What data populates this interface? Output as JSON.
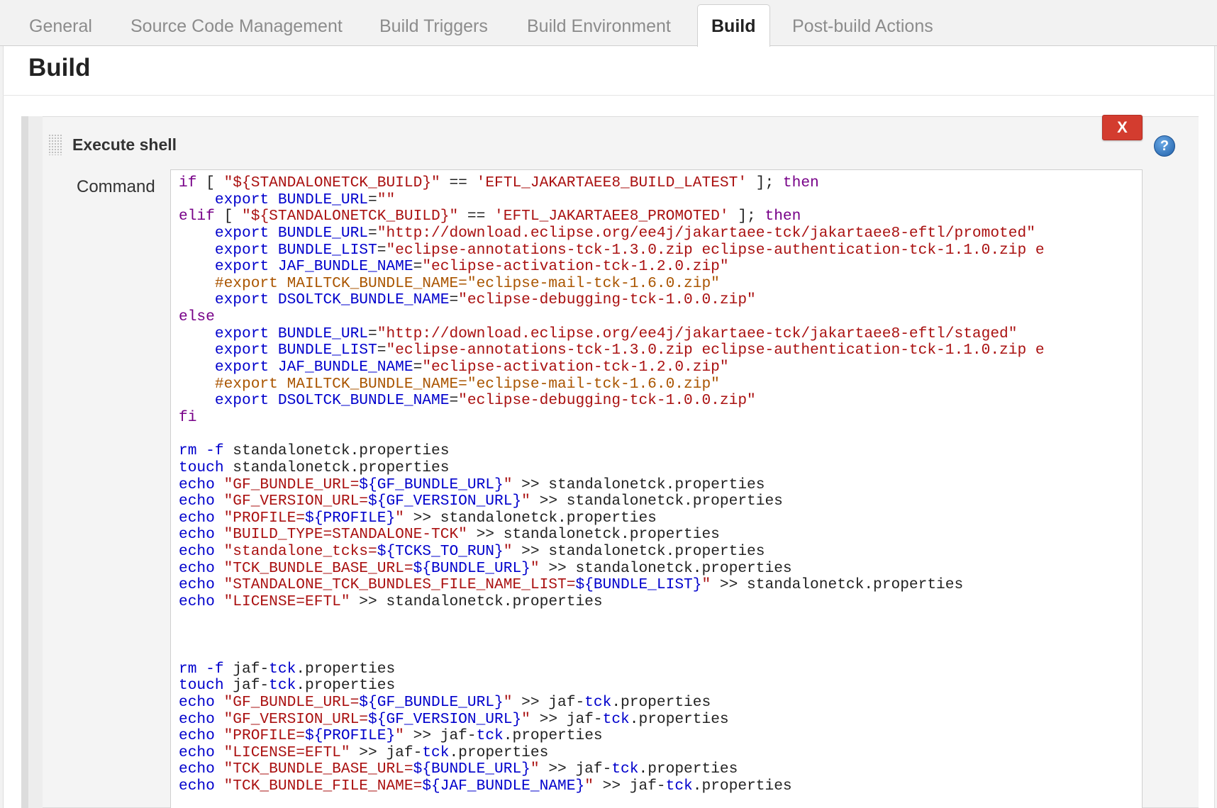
{
  "tabs": [
    {
      "label": "General",
      "active": false
    },
    {
      "label": "Source Code Management",
      "active": false
    },
    {
      "label": "Build Triggers",
      "active": false
    },
    {
      "label": "Build Environment",
      "active": false
    },
    {
      "label": "Build",
      "active": true
    },
    {
      "label": "Post-build Actions",
      "active": false
    }
  ],
  "section": {
    "title": "Build"
  },
  "step": {
    "title": "Execute shell",
    "close_label": "X",
    "help_label": "?",
    "command_label": "Command"
  },
  "colors": {
    "keyword": "#770088",
    "builtin": "#0000cc",
    "string": "#aa1111",
    "comment": "#aa5500",
    "delete_button": "#d33c2f",
    "help_icon": "#1f5fa8"
  },
  "command_lines": [
    [
      [
        "kw",
        "if"
      ],
      [
        "df",
        " [ "
      ],
      [
        "st",
        "\"${STANDALONETCK_BUILD}\""
      ],
      [
        "df",
        " == "
      ],
      [
        "st",
        "'EFTL_JAKARTAEE8_BUILD_LATEST'"
      ],
      [
        "df",
        " ]; "
      ],
      [
        "kw",
        "then"
      ]
    ],
    [
      [
        "df",
        "    "
      ],
      [
        "bi",
        "export"
      ],
      [
        "df",
        " "
      ],
      [
        "bi",
        "BUNDLE_URL"
      ],
      [
        "df",
        "="
      ],
      [
        "st",
        "\"\""
      ]
    ],
    [
      [
        "kw",
        "elif"
      ],
      [
        "df",
        " [ "
      ],
      [
        "st",
        "\"${STANDALONETCK_BUILD}\""
      ],
      [
        "df",
        " == "
      ],
      [
        "st",
        "'EFTL_JAKARTAEE8_PROMOTED'"
      ],
      [
        "df",
        " ]; "
      ],
      [
        "kw",
        "then"
      ]
    ],
    [
      [
        "df",
        "    "
      ],
      [
        "bi",
        "export"
      ],
      [
        "df",
        " "
      ],
      [
        "bi",
        "BUNDLE_URL"
      ],
      [
        "df",
        "="
      ],
      [
        "st",
        "\"http://download.eclipse.org/ee4j/jakartaee-tck/jakartaee8-eftl/promoted\""
      ]
    ],
    [
      [
        "df",
        "    "
      ],
      [
        "bi",
        "export"
      ],
      [
        "df",
        " "
      ],
      [
        "bi",
        "BUNDLE_LIST"
      ],
      [
        "df",
        "="
      ],
      [
        "st",
        "\"eclipse-annotations-tck-1.3.0.zip eclipse-authentication-tck-1.1.0.zip e"
      ]
    ],
    [
      [
        "df",
        "    "
      ],
      [
        "bi",
        "export"
      ],
      [
        "df",
        " "
      ],
      [
        "bi",
        "JAF_BUNDLE_NAME"
      ],
      [
        "df",
        "="
      ],
      [
        "st",
        "\"eclipse-activation-tck-1.2.0.zip\""
      ]
    ],
    [
      [
        "df",
        "    "
      ],
      [
        "cm",
        "#export MAILTCK_BUNDLE_NAME=\"eclipse-mail-tck-1.6.0.zip\""
      ]
    ],
    [
      [
        "df",
        "    "
      ],
      [
        "bi",
        "export"
      ],
      [
        "df",
        " "
      ],
      [
        "bi",
        "DSOLTCK_BUNDLE_NAME"
      ],
      [
        "df",
        "="
      ],
      [
        "st",
        "\"eclipse-debugging-tck-1.0.0.zip\""
      ]
    ],
    [
      [
        "kw",
        "else"
      ]
    ],
    [
      [
        "df",
        "    "
      ],
      [
        "bi",
        "export"
      ],
      [
        "df",
        " "
      ],
      [
        "bi",
        "BUNDLE_URL"
      ],
      [
        "df",
        "="
      ],
      [
        "st",
        "\"http://download.eclipse.org/ee4j/jakartaee-tck/jakartaee8-eftl/staged\""
      ]
    ],
    [
      [
        "df",
        "    "
      ],
      [
        "bi",
        "export"
      ],
      [
        "df",
        " "
      ],
      [
        "bi",
        "BUNDLE_LIST"
      ],
      [
        "df",
        "="
      ],
      [
        "st",
        "\"eclipse-annotations-tck-1.3.0.zip eclipse-authentication-tck-1.1.0.zip e"
      ]
    ],
    [
      [
        "df",
        "    "
      ],
      [
        "bi",
        "export"
      ],
      [
        "df",
        " "
      ],
      [
        "bi",
        "JAF_BUNDLE_NAME"
      ],
      [
        "df",
        "="
      ],
      [
        "st",
        "\"eclipse-activation-tck-1.2.0.zip\""
      ]
    ],
    [
      [
        "df",
        "    "
      ],
      [
        "cm",
        "#export MAILTCK_BUNDLE_NAME=\"eclipse-mail-tck-1.6.0.zip\""
      ]
    ],
    [
      [
        "df",
        "    "
      ],
      [
        "bi",
        "export"
      ],
      [
        "df",
        " "
      ],
      [
        "bi",
        "DSOLTCK_BUNDLE_NAME"
      ],
      [
        "df",
        "="
      ],
      [
        "st",
        "\"eclipse-debugging-tck-1.0.0.zip\""
      ]
    ],
    [
      [
        "kw",
        "fi"
      ]
    ],
    [],
    [
      [
        "bi",
        "rm"
      ],
      [
        "df",
        " "
      ],
      [
        "bi",
        "-f"
      ],
      [
        "df",
        " standalonetck.properties"
      ]
    ],
    [
      [
        "bi",
        "touch"
      ],
      [
        "df",
        " standalonetck.properties"
      ]
    ],
    [
      [
        "bi",
        "echo"
      ],
      [
        "df",
        " "
      ],
      [
        "st",
        "\"GF_BUNDLE_URL="
      ],
      [
        "bi",
        "${GF_BUNDLE_URL}"
      ],
      [
        "st",
        "\""
      ],
      [
        "df",
        " >> standalonetck.properties"
      ]
    ],
    [
      [
        "bi",
        "echo"
      ],
      [
        "df",
        " "
      ],
      [
        "st",
        "\"GF_VERSION_URL="
      ],
      [
        "bi",
        "${GF_VERSION_URL}"
      ],
      [
        "st",
        "\""
      ],
      [
        "df",
        " >> standalonetck.properties"
      ]
    ],
    [
      [
        "bi",
        "echo"
      ],
      [
        "df",
        " "
      ],
      [
        "st",
        "\"PROFILE="
      ],
      [
        "bi",
        "${PROFILE}"
      ],
      [
        "st",
        "\""
      ],
      [
        "df",
        " >> standalonetck.properties"
      ]
    ],
    [
      [
        "bi",
        "echo"
      ],
      [
        "df",
        " "
      ],
      [
        "st",
        "\"BUILD_TYPE=STANDALONE-TCK\""
      ],
      [
        "df",
        " >> standalonetck.properties"
      ]
    ],
    [
      [
        "bi",
        "echo"
      ],
      [
        "df",
        " "
      ],
      [
        "st",
        "\"standalone_tcks="
      ],
      [
        "bi",
        "${TCKS_TO_RUN}"
      ],
      [
        "st",
        "\""
      ],
      [
        "df",
        " >> standalonetck.properties"
      ]
    ],
    [
      [
        "bi",
        "echo"
      ],
      [
        "df",
        " "
      ],
      [
        "st",
        "\"TCK_BUNDLE_BASE_URL="
      ],
      [
        "bi",
        "${BUNDLE_URL}"
      ],
      [
        "st",
        "\""
      ],
      [
        "df",
        " >> standalonetck.properties"
      ]
    ],
    [
      [
        "bi",
        "echo"
      ],
      [
        "df",
        " "
      ],
      [
        "st",
        "\"STANDALONE_TCK_BUNDLES_FILE_NAME_LIST="
      ],
      [
        "bi",
        "${BUNDLE_LIST}"
      ],
      [
        "st",
        "\""
      ],
      [
        "df",
        " >> standalonetck.properties"
      ]
    ],
    [
      [
        "bi",
        "echo"
      ],
      [
        "df",
        " "
      ],
      [
        "st",
        "\"LICENSE=EFTL\""
      ],
      [
        "df",
        " >> standalonetck.properties"
      ]
    ],
    [],
    [],
    [],
    [
      [
        "bi",
        "rm"
      ],
      [
        "df",
        " "
      ],
      [
        "bi",
        "-f"
      ],
      [
        "df",
        " jaf-"
      ],
      [
        "bi",
        "tck"
      ],
      [
        "df",
        ".properties"
      ]
    ],
    [
      [
        "bi",
        "touch"
      ],
      [
        "df",
        " jaf-"
      ],
      [
        "bi",
        "tck"
      ],
      [
        "df",
        ".properties"
      ]
    ],
    [
      [
        "bi",
        "echo"
      ],
      [
        "df",
        " "
      ],
      [
        "st",
        "\"GF_BUNDLE_URL="
      ],
      [
        "bi",
        "${GF_BUNDLE_URL}"
      ],
      [
        "st",
        "\""
      ],
      [
        "df",
        " >> jaf-"
      ],
      [
        "bi",
        "tck"
      ],
      [
        "df",
        ".properties"
      ]
    ],
    [
      [
        "bi",
        "echo"
      ],
      [
        "df",
        " "
      ],
      [
        "st",
        "\"GF_VERSION_URL="
      ],
      [
        "bi",
        "${GF_VERSION_URL}"
      ],
      [
        "st",
        "\""
      ],
      [
        "df",
        " >> jaf-"
      ],
      [
        "bi",
        "tck"
      ],
      [
        "df",
        ".properties"
      ]
    ],
    [
      [
        "bi",
        "echo"
      ],
      [
        "df",
        " "
      ],
      [
        "st",
        "\"PROFILE="
      ],
      [
        "bi",
        "${PROFILE}"
      ],
      [
        "st",
        "\""
      ],
      [
        "df",
        " >> jaf-"
      ],
      [
        "bi",
        "tck"
      ],
      [
        "df",
        ".properties"
      ]
    ],
    [
      [
        "bi",
        "echo"
      ],
      [
        "df",
        " "
      ],
      [
        "st",
        "\"LICENSE=EFTL\""
      ],
      [
        "df",
        " >> jaf-"
      ],
      [
        "bi",
        "tck"
      ],
      [
        "df",
        ".properties"
      ]
    ],
    [
      [
        "bi",
        "echo"
      ],
      [
        "df",
        " "
      ],
      [
        "st",
        "\"TCK_BUNDLE_BASE_URL="
      ],
      [
        "bi",
        "${BUNDLE_URL}"
      ],
      [
        "st",
        "\""
      ],
      [
        "df",
        " >> jaf-"
      ],
      [
        "bi",
        "tck"
      ],
      [
        "df",
        ".properties"
      ]
    ],
    [
      [
        "bi",
        "echo"
      ],
      [
        "df",
        " "
      ],
      [
        "st",
        "\"TCK_BUNDLE_FILE_NAME="
      ],
      [
        "bi",
        "${JAF_BUNDLE_NAME}"
      ],
      [
        "st",
        "\""
      ],
      [
        "df",
        " >> jaf-"
      ],
      [
        "bi",
        "tck"
      ],
      [
        "df",
        ".properties"
      ]
    ]
  ]
}
